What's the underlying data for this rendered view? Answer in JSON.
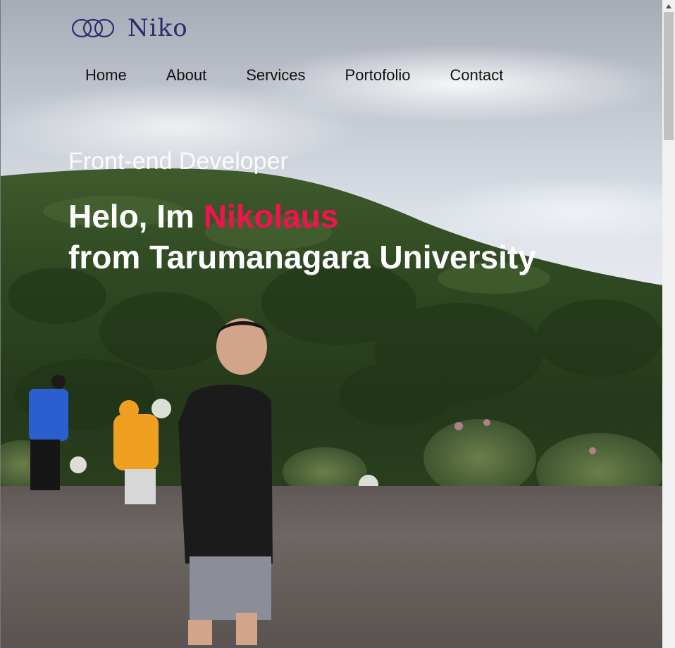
{
  "brand": {
    "logo_icon": "three-interlocking-rings",
    "name": "Niko",
    "color": "#2a2f6e"
  },
  "nav": {
    "items": [
      {
        "label": "Home"
      },
      {
        "label": "About"
      },
      {
        "label": "Services"
      },
      {
        "label": "Portofolio"
      },
      {
        "label": "Contact"
      }
    ]
  },
  "hero": {
    "subtitle": "Front-end Developer",
    "greeting": "Helo, Im ",
    "name": "Nikolaus",
    "line2": "from Tarumanagara University",
    "accent_color": "#f0134d"
  },
  "scrollbar": {
    "up_icon": "triangle-up-icon"
  }
}
